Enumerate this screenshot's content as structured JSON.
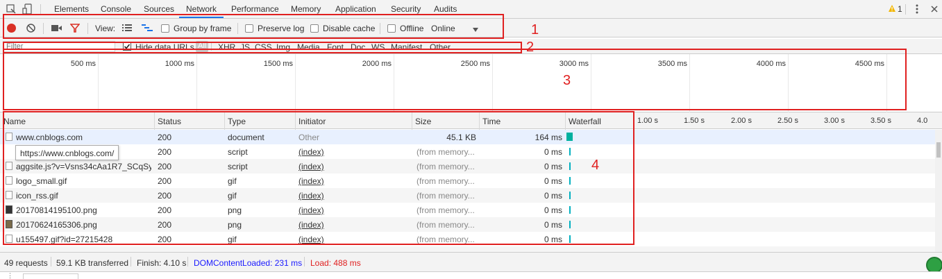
{
  "tabs": [
    "Elements",
    "Console",
    "Sources",
    "Network",
    "Performance",
    "Memory",
    "Application",
    "Security",
    "Audits"
  ],
  "warning_count": "1",
  "toolbar": {
    "view_label": "View:",
    "group_by_frame": "Group by frame",
    "preserve_log": "Preserve log",
    "disable_cache": "Disable cache",
    "offline": "Offline",
    "throttle_value": "Online"
  },
  "filter": {
    "placeholder": "Filter",
    "hide_data_urls": "Hide data URLs",
    "all": "All",
    "types": [
      "XHR",
      "JS",
      "CSS",
      "Img",
      "Media",
      "Font",
      "Doc",
      "WS",
      "Manifest",
      "Other"
    ]
  },
  "overview": {
    "ticks": [
      "500 ms",
      "1000 ms",
      "1500 ms",
      "2000 ms",
      "2500 ms",
      "3000 ms",
      "3500 ms",
      "4000 ms",
      "4500 ms"
    ]
  },
  "table": {
    "headers": {
      "name": "Name",
      "status": "Status",
      "type": "Type",
      "initiator": "Initiator",
      "size": "Size",
      "time": "Time",
      "waterfall": "Waterfall"
    },
    "waterfall_ticks": [
      "1.00 s",
      "1.50 s",
      "2.00 s",
      "2.50 s",
      "3.00 s",
      "3.50 s",
      "4.0"
    ],
    "rows": [
      {
        "name": "www.cnblogs.com",
        "status": "200",
        "type": "document",
        "initiator": "Other",
        "size": "45.1 KB",
        "time": "164 ms"
      },
      {
        "name": "",
        "status": "200",
        "type": "script",
        "initiator": "(index)",
        "size": "(from memory...",
        "time": "0 ms"
      },
      {
        "name": "aggsite.js?v=Vsns34cAa1R7_SCqSy...",
        "status": "200",
        "type": "script",
        "initiator": "(index)",
        "size": "(from memory...",
        "time": "0 ms"
      },
      {
        "name": "logo_small.gif",
        "status": "200",
        "type": "gif",
        "initiator": "(index)",
        "size": "(from memory...",
        "time": "0 ms"
      },
      {
        "name": "icon_rss.gif",
        "status": "200",
        "type": "gif",
        "initiator": "(index)",
        "size": "(from memory...",
        "time": "0 ms"
      },
      {
        "name": "20170814195100.png",
        "status": "200",
        "type": "png",
        "initiator": "(index)",
        "size": "(from memory...",
        "time": "0 ms"
      },
      {
        "name": "20170624165306.png",
        "status": "200",
        "type": "png",
        "initiator": "(index)",
        "size": "(from memory...",
        "time": "0 ms"
      },
      {
        "name": "u155497.gif?id=27215428",
        "status": "200",
        "type": "gif",
        "initiator": "(index)",
        "size": "(from memory...",
        "time": "0 ms"
      }
    ],
    "tooltip": "https://www.cnblogs.com/"
  },
  "status": {
    "requests": "49 requests",
    "transferred": "59.1 KB transferred",
    "finish": "Finish: 4.10 s",
    "dom_content_loaded": "DOMContentLoaded: 231 ms",
    "load": "Load: 488 ms"
  },
  "annotations": [
    "1",
    "2",
    "3",
    "4"
  ],
  "colors": {
    "record_red": "#d93025",
    "annotation_red": "#e02020",
    "dcl_blue": "#1a1aff",
    "load_red": "#e02020",
    "bar_teal": "#00b0a0"
  }
}
